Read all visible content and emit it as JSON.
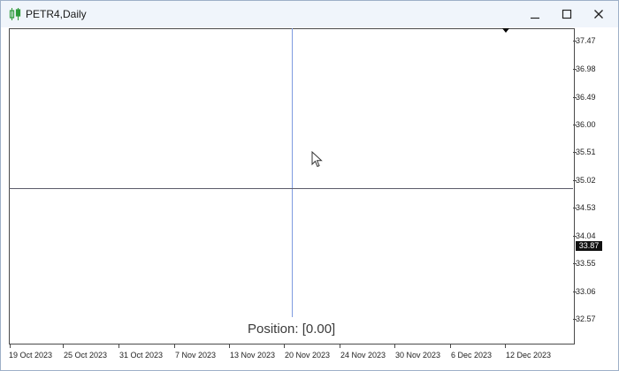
{
  "window": {
    "title": "PETR4,Daily",
    "icon": "candlestick-chart-icon",
    "controls": [
      "minimize-icon",
      "maximize-icon",
      "close-icon"
    ]
  },
  "chart": {
    "price_axis_labels": [
      "37.47",
      "36.98",
      "36.49",
      "36.00",
      "35.51",
      "35.02",
      "34.53",
      "34.04",
      "33.55",
      "33.06",
      "32.57"
    ],
    "current_price": "33.87",
    "time_axis_labels": [
      "19 Oct 2023",
      "25 Oct 2023",
      "31 Oct 2023",
      "7 Nov 2023",
      "13 Nov 2023",
      "20 Nov 2023",
      "24 Nov 2023",
      "30 Nov 2023",
      "6 Dec 2023",
      "12 Dec 2023"
    ],
    "position_text": "Position: [0.00]",
    "colors": {
      "crosshair_vertical": "#7f9be0",
      "crosshair_horizontal": "#5c5c6a",
      "current_price_bg": "#111111"
    }
  }
}
